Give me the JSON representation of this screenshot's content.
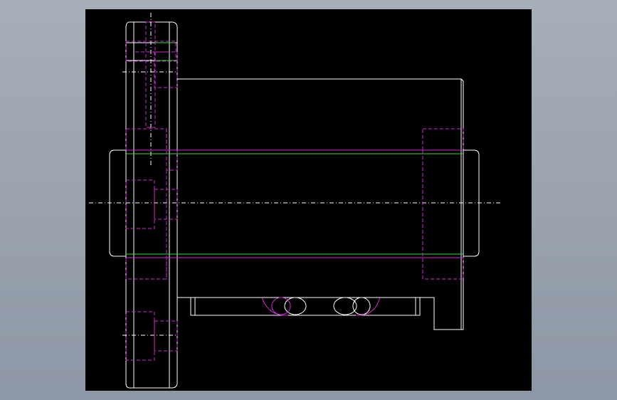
{
  "colors": {
    "background": "#000000",
    "frame": "#9aa2ae",
    "outline": "#ffffff",
    "hidden": "#d12ad1",
    "accent": "#2ee02e",
    "centerline": "#ffffff"
  },
  "drawing": {
    "view": "side-elevation",
    "components": [
      "flange",
      "body",
      "screw-shaft",
      "return-tube",
      "foot"
    ]
  }
}
